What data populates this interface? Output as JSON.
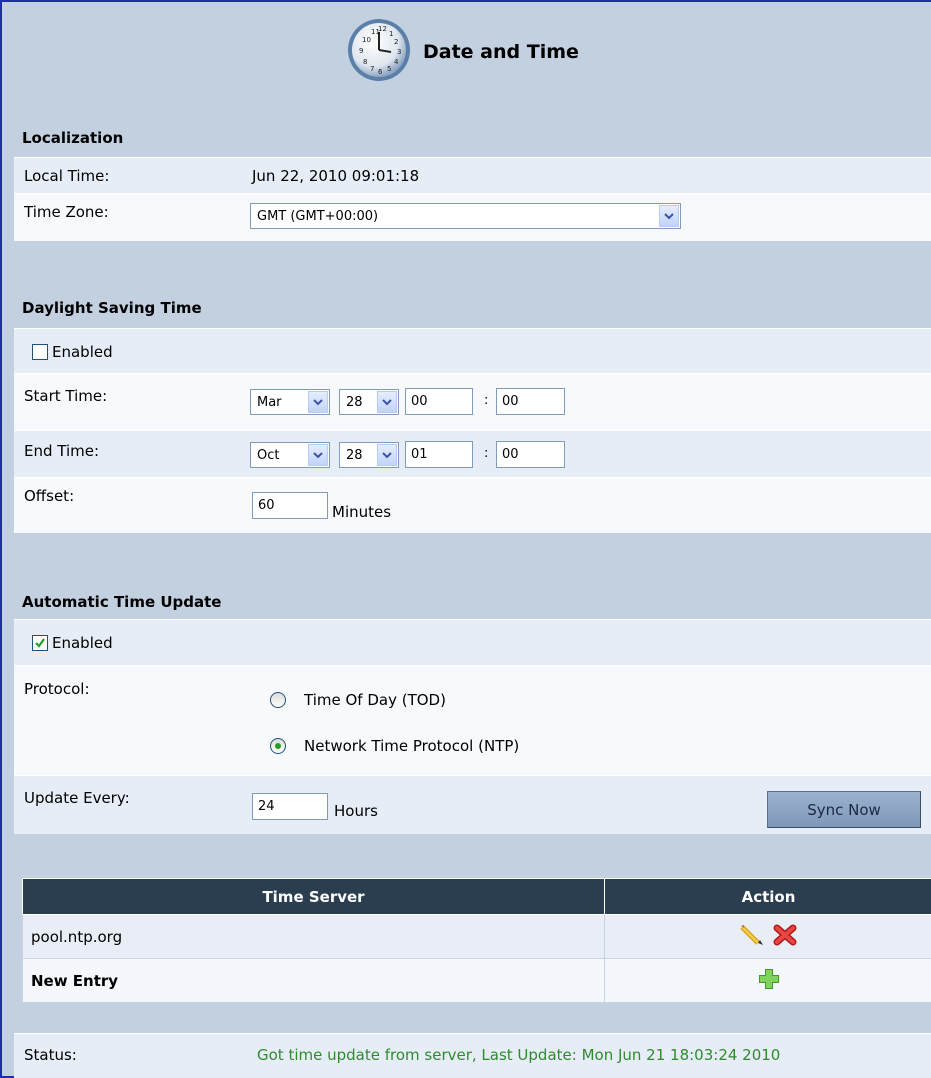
{
  "header": {
    "title": "Date and Time",
    "icon": "clock-icon"
  },
  "localization": {
    "title": "Localization",
    "local_time_label": "Local Time:",
    "local_time_value": "Jun 22, 2010 09:01:18",
    "time_zone_label": "Time Zone:",
    "time_zone_value": "GMT (GMT+00:00)"
  },
  "dst": {
    "title": "Daylight Saving Time",
    "enabled_label": "Enabled",
    "enabled": false,
    "start_label": "Start Time:",
    "start_month": "Mar",
    "start_day": "28",
    "start_hour": "00",
    "start_minute": "00",
    "end_label": "End Time:",
    "end_month": "Oct",
    "end_day": "28",
    "end_hour": "01",
    "end_minute": "00",
    "colon": ":",
    "offset_label": "Offset:",
    "offset_value": "60",
    "offset_unit": "Minutes"
  },
  "auto_update": {
    "title": "Automatic Time Update",
    "enabled_label": "Enabled",
    "enabled": true,
    "protocol_label": "Protocol:",
    "protocol_options": [
      "Time Of Day (TOD)",
      "Network Time Protocol (NTP)"
    ],
    "selected_protocol": "Network Time Protocol (NTP)",
    "update_label": "Update Every:",
    "update_value": "24",
    "update_unit": "Hours",
    "sync_button": "Sync Now"
  },
  "servers": {
    "columns": [
      "Time Server",
      "Action"
    ],
    "rows": [
      {
        "name": "pool.ntp.org"
      }
    ],
    "new_entry": "New Entry"
  },
  "status": {
    "label": "Status:",
    "value": "Got time update from server, Last Update: Mon Jun 21 18:03:24 2010",
    "color": "#2e8b2e"
  }
}
